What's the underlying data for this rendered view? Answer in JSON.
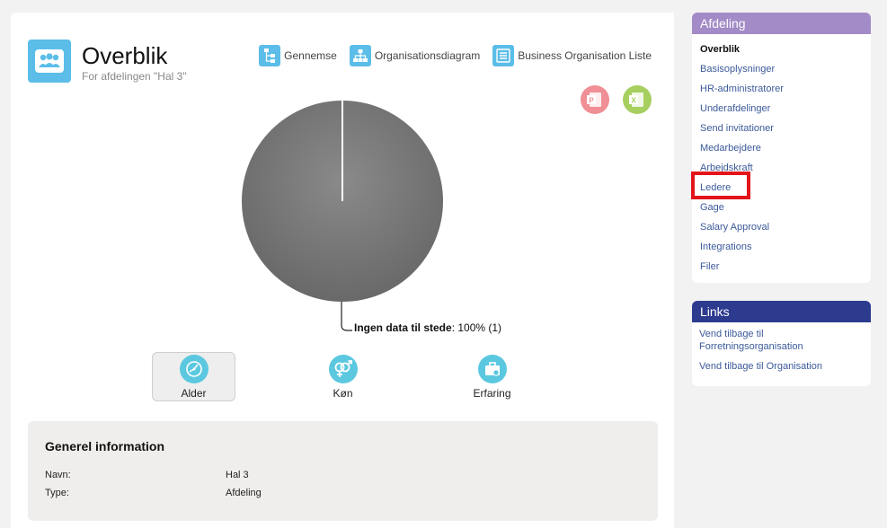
{
  "header": {
    "title": "Overblik",
    "subtitle": "For afdelingen \"Hal 3\"",
    "icon": "group-icon"
  },
  "toolbar": {
    "links": [
      {
        "label": "Gennemse",
        "icon": "tree-icon"
      },
      {
        "label": "Organisationsdiagram",
        "icon": "org-chart-icon"
      },
      {
        "label": "Business Organisation Liste",
        "icon": "list-icon"
      }
    ],
    "export": [
      {
        "icon": "powerpoint-icon",
        "color": "#f08f95"
      },
      {
        "icon": "excel-icon",
        "color": "#a7cf5f"
      }
    ]
  },
  "chart_data": {
    "type": "pie",
    "slices": [
      {
        "label": "Ingen data til stede",
        "value": 100,
        "count": 1,
        "color": "#777777"
      }
    ],
    "label_text": {
      "name": "Ingen data til stede",
      "suffix": ": 100% (1)"
    }
  },
  "chart_tabs": [
    {
      "label": "Alder",
      "icon": "age-chart-icon",
      "active": true
    },
    {
      "label": "Køn",
      "icon": "gender-icon",
      "active": false
    },
    {
      "label": "Erfaring",
      "icon": "briefcase-icon",
      "active": false
    }
  ],
  "general": {
    "title": "Generel information",
    "rows": [
      {
        "key": "Navn:",
        "value": "Hal 3"
      },
      {
        "key": "Type:",
        "value": "Afdeling"
      }
    ]
  },
  "sidebar": {
    "title": "Afdeling",
    "accent": "#a28bc7",
    "items": [
      {
        "label": "Overblik",
        "current": true
      },
      {
        "label": "Basisoplysninger"
      },
      {
        "label": "HR-administratorer"
      },
      {
        "label": "Underafdelinger"
      },
      {
        "label": "Send invitationer"
      },
      {
        "label": "Medarbejdere"
      },
      {
        "label": "Arbejdskraft"
      },
      {
        "label": "Ledere"
      },
      {
        "label": "Gage"
      },
      {
        "label": "Salary Approval"
      },
      {
        "label": "Integrations"
      },
      {
        "label": "Filer"
      }
    ]
  },
  "links_box": {
    "title": "Links",
    "accent": "#2d3b8f",
    "items": [
      {
        "label": "Vend tilbage til Forretningsorganisation"
      },
      {
        "label": "Vend tilbage til Organisation"
      }
    ]
  },
  "highlight": {
    "target": "Ledere",
    "color": "#e3141a"
  }
}
